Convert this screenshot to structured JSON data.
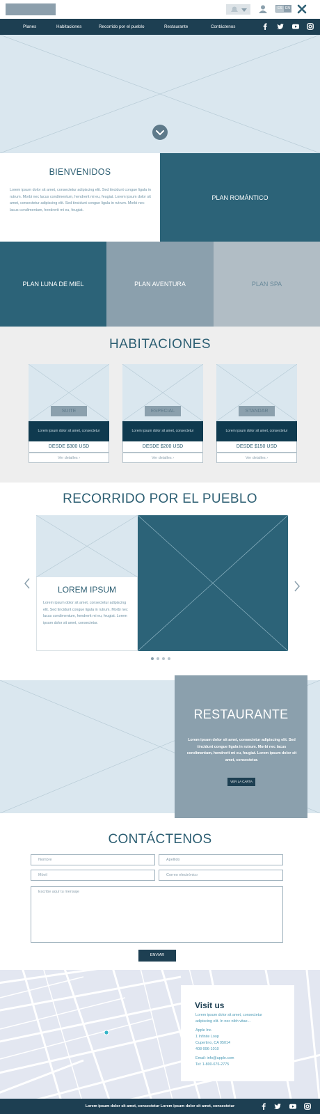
{
  "header": {
    "lang_options": [
      "ES",
      "EN"
    ]
  },
  "nav": {
    "items": [
      "Planes",
      "Habitaciones",
      "Recorrido por el pueblo",
      "Restaurante",
      "Contáctenos"
    ]
  },
  "welcome": {
    "title": "BIENVENIDOS",
    "text": "Lorem ipsum dolor sit amet, consectetur adipiscing elit. Sed tincidunt congue ligula in rutrum. Morbi nec lacus condimentum, hendrerit mi eu, feugiat. Lorem ipsum dolor sit amet, consectetur adipiscing elit. Sed tincidunt congue ligula in rutrum. Morbi nec lacus condimentum, hendrerit mi eu, feugiat."
  },
  "plans": {
    "romantico": "PLAN ROMÁNTICO",
    "luna_de_miel": "PLAN LUNA DE MIEL",
    "aventura": "PLAN AVENTURA",
    "spa": "PLAN SPA"
  },
  "rooms": {
    "title": "HABITACIONES",
    "items": [
      {
        "tag": "SUITE",
        "desc": "Lorem ipsum dolor sit amet, consectetur",
        "price": "DESDE $300 USD",
        "link": "Ver detalles"
      },
      {
        "tag": "ESPECIAL",
        "desc": "Lorem ipsum dolor sit amet, consectetur",
        "price": "DESDE $200 USD",
        "link": "Ver detalles"
      },
      {
        "tag": "STANDAR",
        "desc": "Lorem ipsum dolor sit amet, consectetur",
        "price": "DESDE $150 USD",
        "link": "Ver detalles"
      }
    ]
  },
  "tour": {
    "title": "RECORRIDO POR EL PUEBLO",
    "card_title": "LOREM IPSUM",
    "card_text": "Lorem ipsum dolor sit amet, consectetur adipiscing elit. Sed tincidunt congue ligula in rutrum. Morbi nec lacus condimentum, hendrerit mi eu, feugiat. Lorem ipsum dolor sit amet, consectetur."
  },
  "restaurant": {
    "title": "RESTAURANTE",
    "text": "Lorem ipsum dolor sit amet, consectetur adipiscing elit. Sed tincidunt congue ligula in rutrum. Morbi nec lacus condimentum, hendrerit mi eu, feugiat. Lorem ipsum dolor sit amet, consectetur.",
    "button": "VER LA CARTA"
  },
  "contact": {
    "title": "CONTÁCTENOS",
    "name_placeholder": "Nombre",
    "lastname_placeholder": "Apellido",
    "mobile_placeholder": "Móvil",
    "email_placeholder": "Correo electrónico",
    "message_placeholder": "Escribe aquí tu mensaje",
    "send": "ENVIAR"
  },
  "visit": {
    "title": "Visit us",
    "lines": [
      "Lorem ipsum dolor sit amet, consectetur",
      "adipiscing elit. In nec nibh vitae...",
      "Apple Inc.",
      "1 Infinite Loop",
      "Cupertino, CA 95014",
      "408-996-1010",
      "Email: info@apple.com",
      "Tel: 1-800-676-2775"
    ]
  },
  "footer": {
    "text": "Lorem ipsum dolor sit amet, consectetur Lorem ipsum dolor sit amet, consectetur"
  },
  "colors": {
    "navy": "#1d3f52",
    "teal": "#2c6378",
    "slate": "#8ba0ad",
    "light": "#dae7ef"
  }
}
